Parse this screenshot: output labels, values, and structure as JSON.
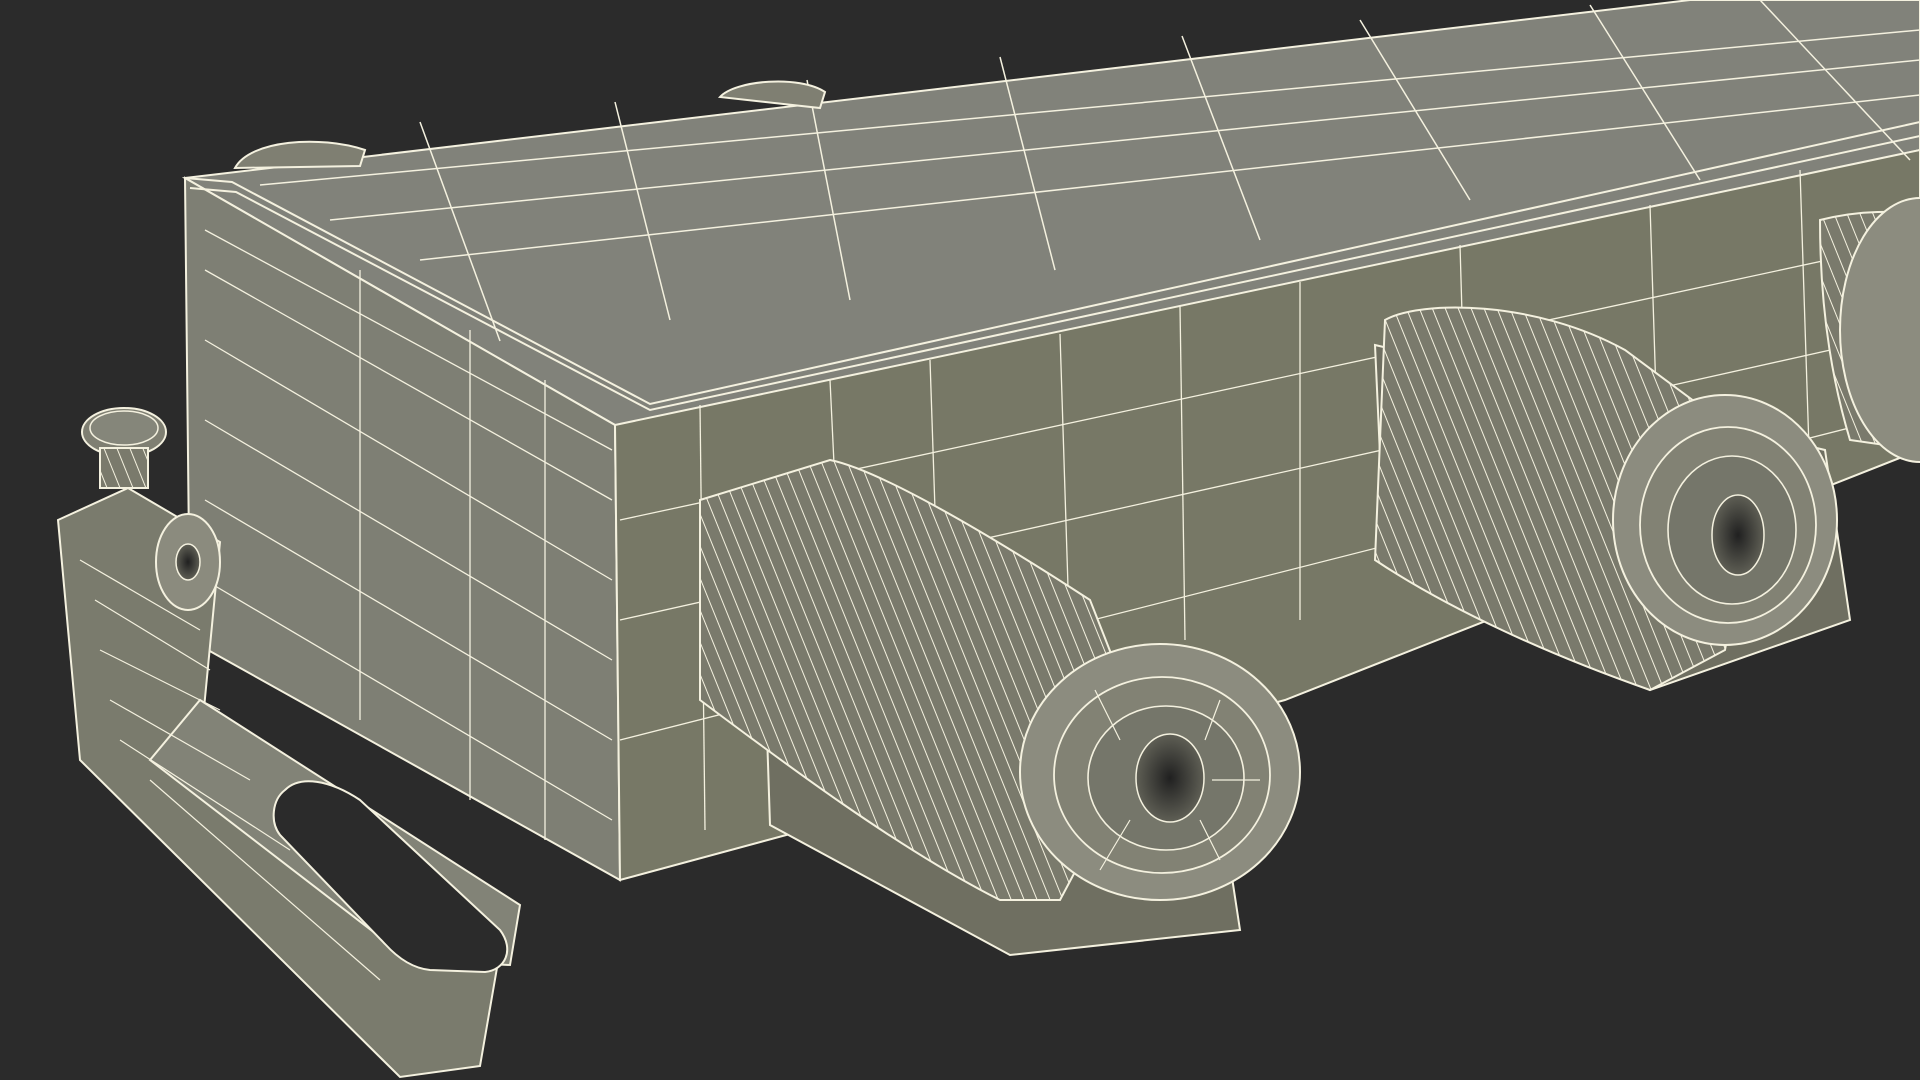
{
  "scene": {
    "background_color": "#2b2b2b",
    "surface_color": "#7f7f72",
    "top_color": "#82827a",
    "shadow_color": "#676759",
    "wire_color": "#f4f1df"
  }
}
